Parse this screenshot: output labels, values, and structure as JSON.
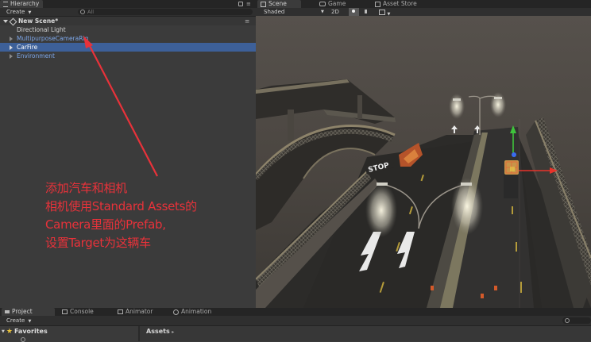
{
  "hierarchy": {
    "tab_label": "Hierarchy",
    "create_label": "Create",
    "search_placeholder": "All",
    "scene_name": "New Scene*",
    "items": [
      {
        "label": "Directional Light"
      },
      {
        "label": "MultipurposeCameraRig"
      },
      {
        "label": "CarFire"
      },
      {
        "label": "Environment"
      }
    ]
  },
  "scene": {
    "tabs": [
      "Scene",
      "Game",
      "Asset Store"
    ],
    "shading_mode": "Shaded",
    "mode_2d": "2D",
    "road_text": "STOP"
  },
  "annotation": {
    "lines": [
      "添加汽车和相机",
      "相机使用Standard Assets的",
      "Camera里面的Prefab,",
      "设置Target为这辆车"
    ],
    "color": "#e8323a"
  },
  "bottom": {
    "tabs": [
      "Project",
      "Console",
      "Animator",
      "Animation"
    ],
    "create_label": "Create",
    "favorites_label": "Favorites",
    "assets_label": "Assets"
  },
  "colors": {
    "selection": "#3d6099",
    "prefab_text": "#7da7ea",
    "gizmo_red": "#e8332a",
    "gizmo_green": "#3fc43c",
    "gizmo_blue": "#3a6cf0"
  }
}
